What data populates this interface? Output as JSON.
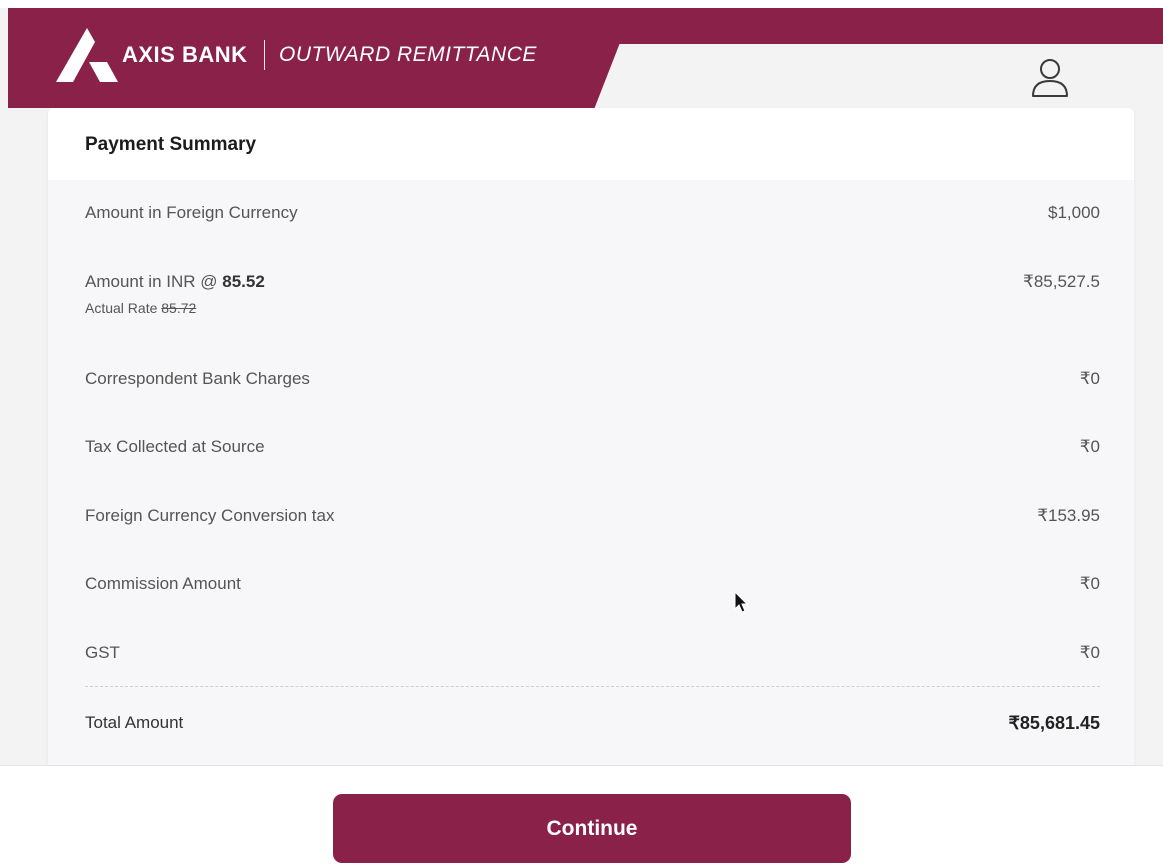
{
  "header": {
    "brand_name": "AXIS BANK",
    "product_name": "OUTWARD REMITTANCE",
    "logo_icon": "axis-bank-logo-icon",
    "user_icon": "user-profile-icon",
    "brand_color": "#8a2149"
  },
  "summary": {
    "title": "Payment Summary",
    "rows": [
      {
        "label": "Amount in Foreign Currency",
        "value": "$1,000"
      },
      {
        "label_prefix": "Amount in INR @ ",
        "rate": "85.52",
        "value": "₹85,527.5",
        "actual_rate_label": "Actual Rate ",
        "actual_rate": "85.72"
      },
      {
        "label": "Correspondent Bank Charges",
        "value": "₹0"
      },
      {
        "label": "Tax Collected at Source",
        "value": "₹0"
      },
      {
        "label": "Foreign Currency Conversion tax",
        "value": "₹153.95"
      },
      {
        "label": "Commission Amount",
        "value": "₹0"
      },
      {
        "label": "GST",
        "value": "₹0"
      }
    ],
    "total": {
      "label": "Total Amount",
      "value": "₹85,681.45"
    }
  },
  "footer": {
    "continue_label": "Continue"
  }
}
